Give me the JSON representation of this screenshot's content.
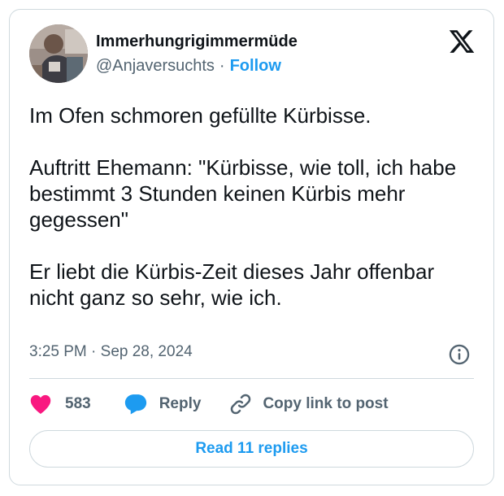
{
  "author": {
    "display_name": "Immerhungrigimmermüde",
    "handle": "@Anjaversuchts",
    "separator": "·",
    "follow_label": "Follow"
  },
  "tweet": {
    "paragraphs": [
      "Im Ofen schmoren gefüllte Kürbisse.",
      "Auftritt Ehemann: \"Kürbisse, wie toll, ich habe bestimmt 3 Stunden keinen Kürbis mehr gegessen\"",
      "Er liebt die Kürbis-Zeit dieses Jahr offenbar nicht ganz so sehr, wie ich."
    ],
    "time": "3:25 PM",
    "separator": "·",
    "date": "Sep 28, 2024"
  },
  "actions": {
    "like_count": "583",
    "reply_label": "Reply",
    "copy_label": "Copy link to post"
  },
  "read_replies_label": "Read 11 replies",
  "icons": {
    "brand": "x-logo-icon",
    "info": "info-icon",
    "like": "heart-icon",
    "reply": "speech-bubble-icon",
    "copy": "link-icon"
  },
  "colors": {
    "accent": "#1d9bf0",
    "like": "#f91880",
    "text": "#0f1419",
    "secondary_text": "#536471",
    "border": "#cfd9de"
  }
}
